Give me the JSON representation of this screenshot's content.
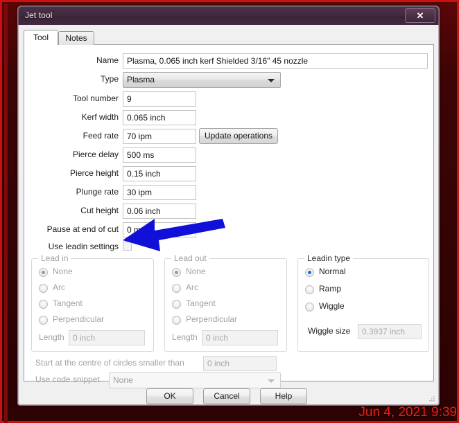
{
  "window": {
    "title": "Jet tool",
    "close_label": "✕"
  },
  "tabs": [
    {
      "label": "Tool",
      "active": true
    },
    {
      "label": "Notes",
      "active": false
    }
  ],
  "fields": {
    "name": {
      "label": "Name",
      "value": "Plasma, 0.065 inch kerf Shielded 3/16\" 45 nozzle"
    },
    "type": {
      "label": "Type",
      "value": "Plasma"
    },
    "tool_number": {
      "label": "Tool number",
      "value": "9"
    },
    "kerf_width": {
      "label": "Kerf width",
      "value": "0.065 inch"
    },
    "feed_rate": {
      "label": "Feed rate",
      "value": "70 ipm"
    },
    "pierce_delay": {
      "label": "Pierce delay",
      "value": "500 ms"
    },
    "pierce_height": {
      "label": "Pierce height",
      "value": "0.15 inch"
    },
    "plunge_rate": {
      "label": "Plunge rate",
      "value": "30 ipm"
    },
    "cut_height": {
      "label": "Cut height",
      "value": "0.06 inch"
    },
    "pause_end_cut": {
      "label": "Pause at end of cut",
      "value": "0 ms"
    },
    "use_leadin": {
      "label": "Use leadin settings",
      "checked": false
    }
  },
  "update_operations_button": {
    "label": "Update operations"
  },
  "lead_in": {
    "title": "Lead in",
    "enabled": false,
    "options": [
      {
        "label": "None",
        "selected": true
      },
      {
        "label": "Arc",
        "selected": false
      },
      {
        "label": "Tangent",
        "selected": false
      },
      {
        "label": "Perpendicular",
        "selected": false
      }
    ],
    "length": {
      "label": "Length",
      "value": "0 inch"
    }
  },
  "lead_out": {
    "title": "Lead out",
    "enabled": false,
    "options": [
      {
        "label": "None",
        "selected": true
      },
      {
        "label": "Arc",
        "selected": false
      },
      {
        "label": "Tangent",
        "selected": false
      },
      {
        "label": "Perpendicular",
        "selected": false
      }
    ],
    "length": {
      "label": "Length",
      "value": "0 inch"
    }
  },
  "leadin_type": {
    "title": "Leadin type",
    "enabled": true,
    "options": [
      {
        "label": "Normal",
        "selected": true
      },
      {
        "label": "Ramp",
        "selected": false
      },
      {
        "label": "Wiggle",
        "selected": false
      }
    ],
    "wiggle_size": {
      "label": "Wiggle size",
      "value": "0.3937 inch"
    }
  },
  "start_centre": {
    "label": "Start at the centre of circles smaller than",
    "value": "0 inch"
  },
  "code_snippet": {
    "label": "Use code snippet",
    "value": "None"
  },
  "footer": {
    "ok": "OK",
    "cancel": "Cancel",
    "help": "Help"
  },
  "annotation": {
    "arrow_color": "#1010d8"
  },
  "overlay": {
    "timestamp": "Jun 4, 2021 9:39"
  },
  "colors": {
    "desktop_background": "#3d0404",
    "desktop_border": "#c9110f",
    "titlebar": "#43293f",
    "accent_radio": "#1a6fd4",
    "timestamp_text": "#e8201c"
  }
}
